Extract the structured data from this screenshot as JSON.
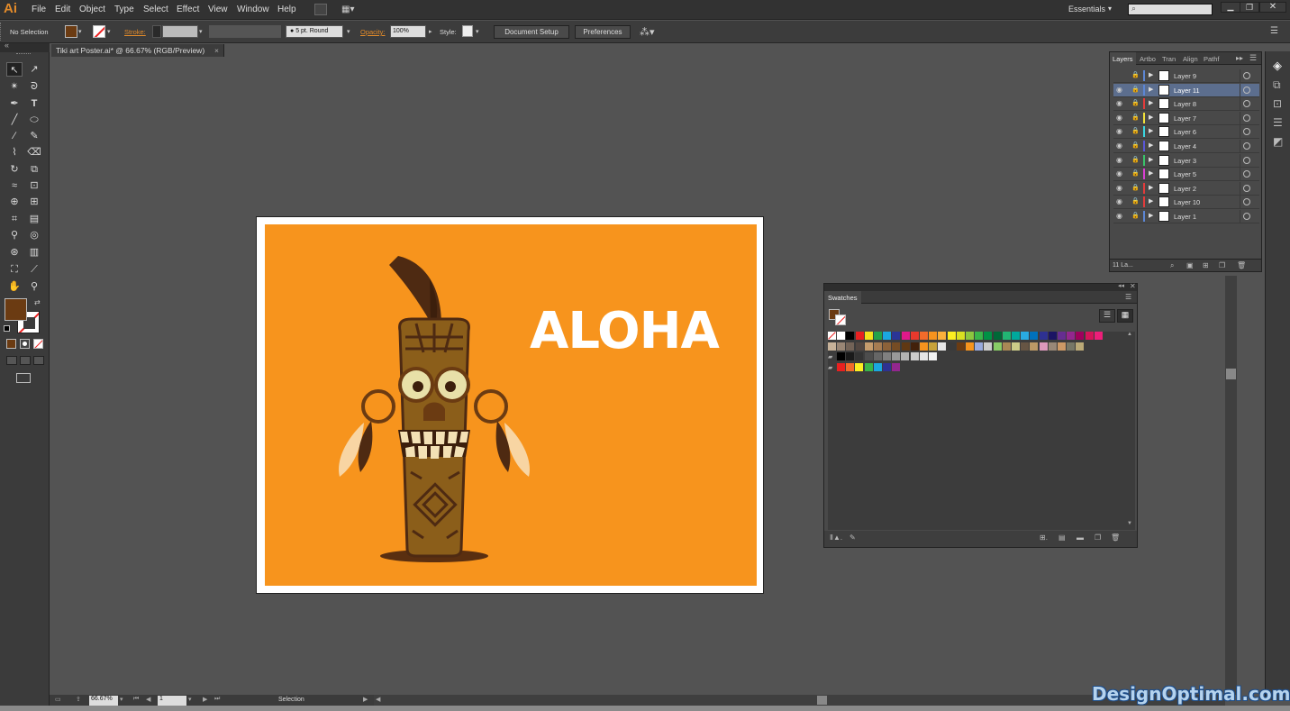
{
  "app": {
    "logo": "Ai"
  },
  "menu": [
    "File",
    "Edit",
    "Object",
    "Type",
    "Select",
    "Effect",
    "View",
    "Window",
    "Help"
  ],
  "workspace": {
    "label": "Essentials"
  },
  "control": {
    "selection": "No Selection",
    "stroke_label": "Stroke:",
    "brush": "5 pt. Round",
    "opacity_label": "Opacity:",
    "opacity": "100%",
    "style_label": "Style:",
    "doc_setup": "Document Setup",
    "preferences": "Preferences"
  },
  "document": {
    "tab": "Tiki art Poster.ai* @ 66.67% (RGB/Preview)",
    "close": "×"
  },
  "artwork": {
    "headline": "ALOHA"
  },
  "layers_panel": {
    "tabs": [
      "Layers",
      "Artbo",
      "Tran",
      "Align",
      "Pathf"
    ],
    "layers": [
      "Layer 9",
      "Layer 11",
      "Layer 8",
      "Layer 7",
      "Layer 6",
      "Layer 4",
      "Layer 3",
      "Layer 5",
      "Layer 2",
      "Layer 10",
      "Layer 1"
    ],
    "colors": [
      "#5c86d4",
      "#5c86d4",
      "#e23b3b",
      "#f0e03a",
      "#3ad6e0",
      "#5a57d8",
      "#3ac26a",
      "#d93fd3",
      "#e23b3b",
      "#e23b3b",
      "#5c86d4"
    ],
    "footer": "11 La..."
  },
  "swatches_panel": {
    "title": "Swatches"
  },
  "status": {
    "zoom": "66.67%",
    "page": "1",
    "tool": "Selection"
  },
  "watermark": "DesignOptimal.com"
}
